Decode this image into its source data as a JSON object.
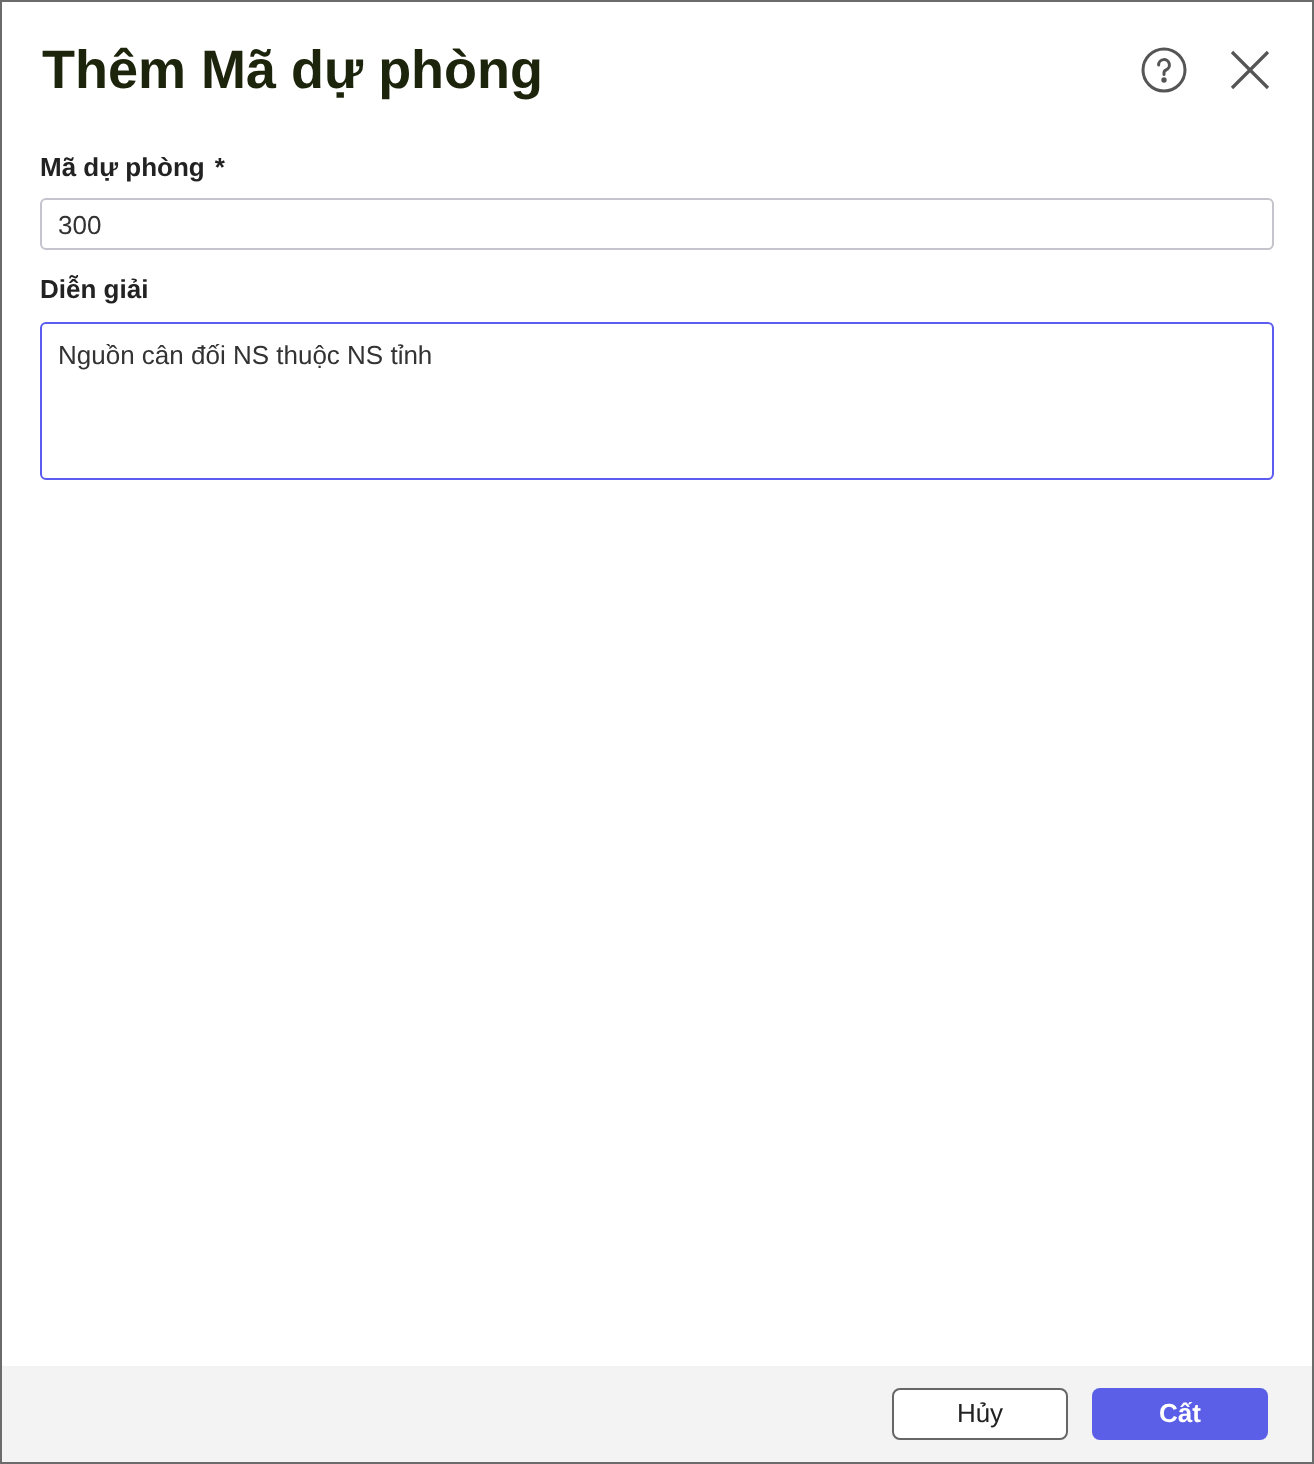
{
  "dialog": {
    "title": "Thêm Mã dự phòng"
  },
  "fields": [
    {
      "kind": "input",
      "label": "Mã dự phòng",
      "required_mark": "*",
      "value": "300",
      "focused": false
    },
    {
      "kind": "textarea",
      "label": "Diễn giải",
      "value": "Nguồn cân đối NS thuộc NS tỉnh",
      "focused": true
    }
  ],
  "buttons": [
    {
      "label": "Hủy",
      "kind": "secondary"
    },
    {
      "label": "Cất",
      "kind": "primary"
    }
  ]
}
